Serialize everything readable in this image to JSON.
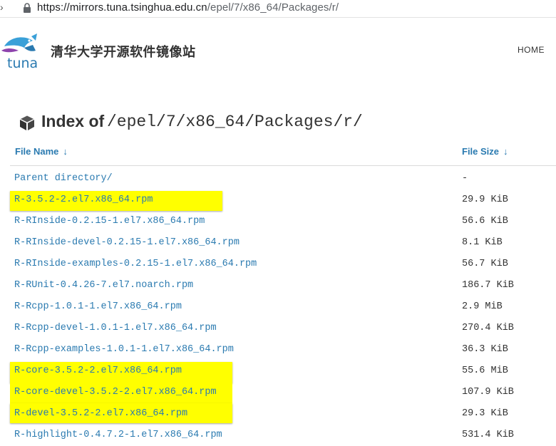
{
  "browser": {
    "url_scheme": "https://",
    "url_host": "mirrors.tuna.tsinghua.edu.cn",
    "url_path": "/epel/7/x86_64/Packages/r/"
  },
  "site": {
    "logo_text": "tuna",
    "title": "清华大学开源软件镜像站",
    "nav_home": "HOME",
    "brand_color": "#2a7ab0"
  },
  "index": {
    "label": "Index of",
    "path": "/epel/7/x86_64/Packages/r/",
    "icon": "box-icon"
  },
  "table": {
    "columns": [
      {
        "label": "File Name",
        "sort_icon": "↓"
      },
      {
        "label": "File Size",
        "sort_icon": "↓"
      }
    ],
    "highlight_color": "#ffff00",
    "rows": [
      {
        "name": "Parent directory/",
        "size": "-",
        "highlighted": false
      },
      {
        "name": "R-3.5.2-2.el7.x86_64.rpm",
        "size": "29.9 KiB",
        "highlighted": true
      },
      {
        "name": "R-RInside-0.2.15-1.el7.x86_64.rpm",
        "size": "56.6 KiB",
        "highlighted": false
      },
      {
        "name": "R-RInside-devel-0.2.15-1.el7.x86_64.rpm",
        "size": "8.1 KiB",
        "highlighted": false
      },
      {
        "name": "R-RInside-examples-0.2.15-1.el7.x86_64.rpm",
        "size": "56.7 KiB",
        "highlighted": false
      },
      {
        "name": "R-RUnit-0.4.26-7.el7.noarch.rpm",
        "size": "186.7 KiB",
        "highlighted": false
      },
      {
        "name": "R-Rcpp-1.0.1-1.el7.x86_64.rpm",
        "size": "2.9 MiB",
        "highlighted": false
      },
      {
        "name": "R-Rcpp-devel-1.0.1-1.el7.x86_64.rpm",
        "size": "270.4 KiB",
        "highlighted": false
      },
      {
        "name": "R-Rcpp-examples-1.0.1-1.el7.x86_64.rpm",
        "size": "36.3 KiB",
        "highlighted": false
      },
      {
        "name": "R-core-3.5.2-2.el7.x86_64.rpm",
        "size": "55.6 MiB",
        "highlighted": true
      },
      {
        "name": "R-core-devel-3.5.2-2.el7.x86_64.rpm",
        "size": "107.9 KiB",
        "highlighted": true
      },
      {
        "name": "R-devel-3.5.2-2.el7.x86_64.rpm",
        "size": "29.3 KiB",
        "highlighted": true
      },
      {
        "name": "R-highlight-0.4.7.2-1.el7.x86_64.rpm",
        "size": "531.4 KiB",
        "highlighted": false
      }
    ]
  }
}
